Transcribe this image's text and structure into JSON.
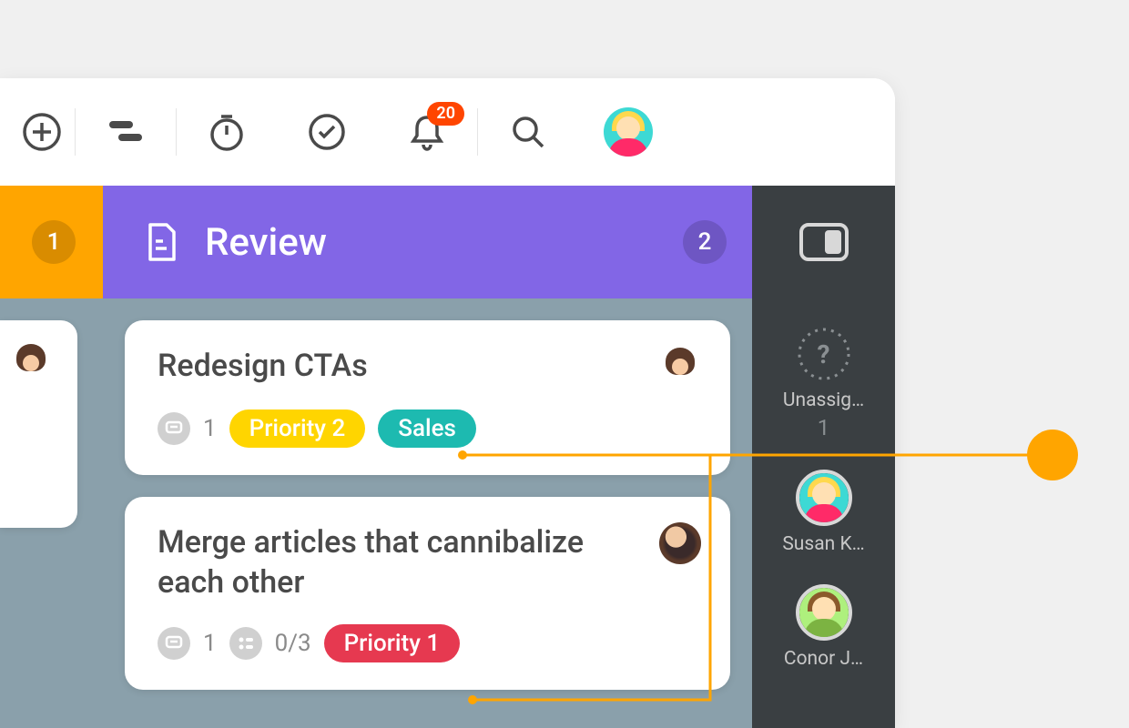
{
  "toolbar": {
    "notifications_count": "20"
  },
  "columns": {
    "left": {
      "count": "1"
    },
    "review": {
      "title": "Review",
      "count": "2"
    }
  },
  "cards": [
    {
      "title": "Redesign CTAs",
      "comments": "1",
      "tags": [
        {
          "label": "Priority 2",
          "color": "yellow"
        },
        {
          "label": "Sales",
          "color": "teal"
        }
      ]
    },
    {
      "title": "Merge articles that cannibalize each other",
      "comments": "1",
      "subtasks": "0/3",
      "tags": [
        {
          "label": "Priority 1",
          "color": "red"
        }
      ]
    }
  ],
  "sidebar": {
    "users": [
      {
        "label": "Unassig…",
        "count": "1"
      },
      {
        "label": "Susan K…"
      },
      {
        "label": "Conor J…"
      }
    ]
  },
  "colors": {
    "accent_orange": "#ffa500",
    "col_purple": "#8266e6",
    "sidebar_dark": "#3a3f42",
    "tag_yellow": "#ffd500",
    "tag_teal": "#1dbab0",
    "tag_red": "#e63950",
    "badge_red": "#ff4500"
  }
}
